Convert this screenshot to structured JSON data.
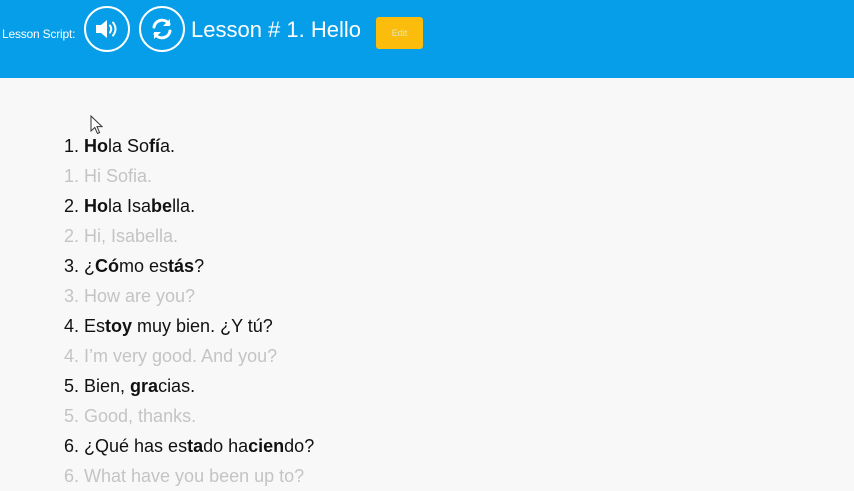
{
  "header": {
    "script_label": "Lesson Script:",
    "audio_button_icon": "speaker-icon",
    "reload_button_icon": "refresh-icon",
    "title": "Lesson # 1. Hello",
    "badge_label": "Edit",
    "background_color": "#069ee8",
    "badge_color": "#fbbc0b"
  },
  "lines": [
    {
      "lang": "es",
      "segments": [
        {
          "t": "1. "
        },
        {
          "t": "Ho",
          "b": true
        },
        {
          "t": "la So"
        },
        {
          "t": "fí",
          "b": true
        },
        {
          "t": "a."
        }
      ]
    },
    {
      "lang": "en",
      "segments": [
        {
          "t": "1. Hi Sofia."
        }
      ]
    },
    {
      "lang": "es",
      "segments": [
        {
          "t": "2. "
        },
        {
          "t": "Ho",
          "b": true
        },
        {
          "t": "la Isa"
        },
        {
          "t": "be",
          "b": true
        },
        {
          "t": "lla."
        }
      ]
    },
    {
      "lang": "en",
      "segments": [
        {
          "t": "2. Hi, Isabella."
        }
      ]
    },
    {
      "lang": "es",
      "segments": [
        {
          "t": "3. ¿"
        },
        {
          "t": "Có",
          "b": true
        },
        {
          "t": "mo es"
        },
        {
          "t": "tás",
          "b": true
        },
        {
          "t": "?"
        }
      ]
    },
    {
      "lang": "en",
      "segments": [
        {
          "t": "3. How are you?"
        }
      ]
    },
    {
      "lang": "es",
      "segments": [
        {
          "t": "4. Es"
        },
        {
          "t": "toy",
          "b": true
        },
        {
          "t": " muy bien. ¿Y tú?"
        }
      ]
    },
    {
      "lang": "en",
      "segments": [
        {
          "t": "4. I’m very good. And you?"
        }
      ]
    },
    {
      "lang": "es",
      "segments": [
        {
          "t": "5. Bien, "
        },
        {
          "t": "gra",
          "b": true
        },
        {
          "t": "cias."
        }
      ]
    },
    {
      "lang": "en",
      "segments": [
        {
          "t": "5. Good, thanks."
        }
      ]
    },
    {
      "lang": "es",
      "segments": [
        {
          "t": "6. ¿Qué has es"
        },
        {
          "t": "ta",
          "b": true
        },
        {
          "t": "do ha"
        },
        {
          "t": "cien",
          "b": true
        },
        {
          "t": "do?"
        }
      ]
    },
    {
      "lang": "en",
      "segments": [
        {
          "t": "6. What have you been up to?"
        }
      ]
    }
  ]
}
